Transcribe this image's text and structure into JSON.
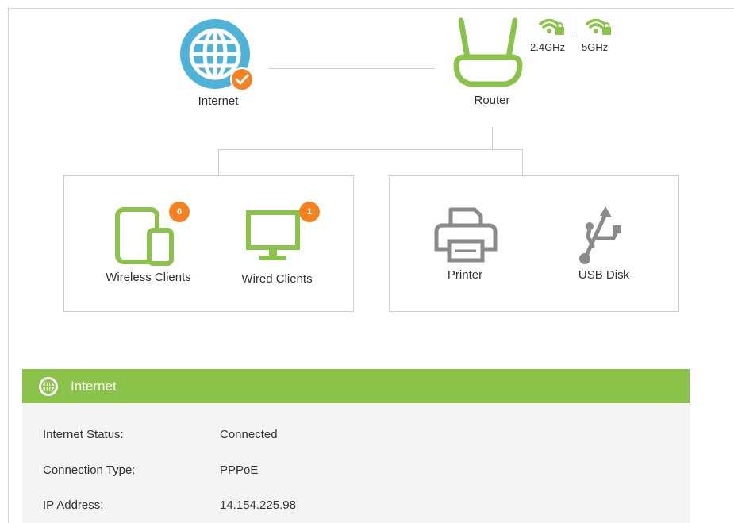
{
  "topology": {
    "internet": {
      "label": "Internet",
      "status_icon": "check-badge-icon",
      "icon": "globe-icon"
    },
    "router": {
      "label": "Router",
      "icon": "router-icon"
    },
    "bands": [
      {
        "label": "2.4GHz",
        "icon": "wifi-lock-icon"
      },
      {
        "label": "5GHz",
        "icon": "wifi-lock-icon"
      }
    ]
  },
  "clients": {
    "wireless": {
      "label": "Wireless Clients",
      "count": "0",
      "icon": "tablet-phone-icon"
    },
    "wired": {
      "label": "Wired Clients",
      "count": "1",
      "icon": "monitor-icon"
    }
  },
  "peripherals": {
    "printer": {
      "label": "Printer",
      "icon": "printer-icon"
    },
    "usb": {
      "label": "USB Disk",
      "icon": "usb-icon"
    }
  },
  "internet_panel": {
    "title": "Internet",
    "rows": [
      {
        "label": "Internet Status:",
        "value": "Connected"
      },
      {
        "label": "Connection Type:",
        "value": "PPPoE"
      },
      {
        "label": "IP Address:",
        "value": "14.154.225.98"
      }
    ]
  },
  "colors": {
    "accent_green": "#8bc34a",
    "globe_blue": "#4fb3d9",
    "badge_orange": "#f58220",
    "peripheral_gray": "#8a8a8a"
  }
}
